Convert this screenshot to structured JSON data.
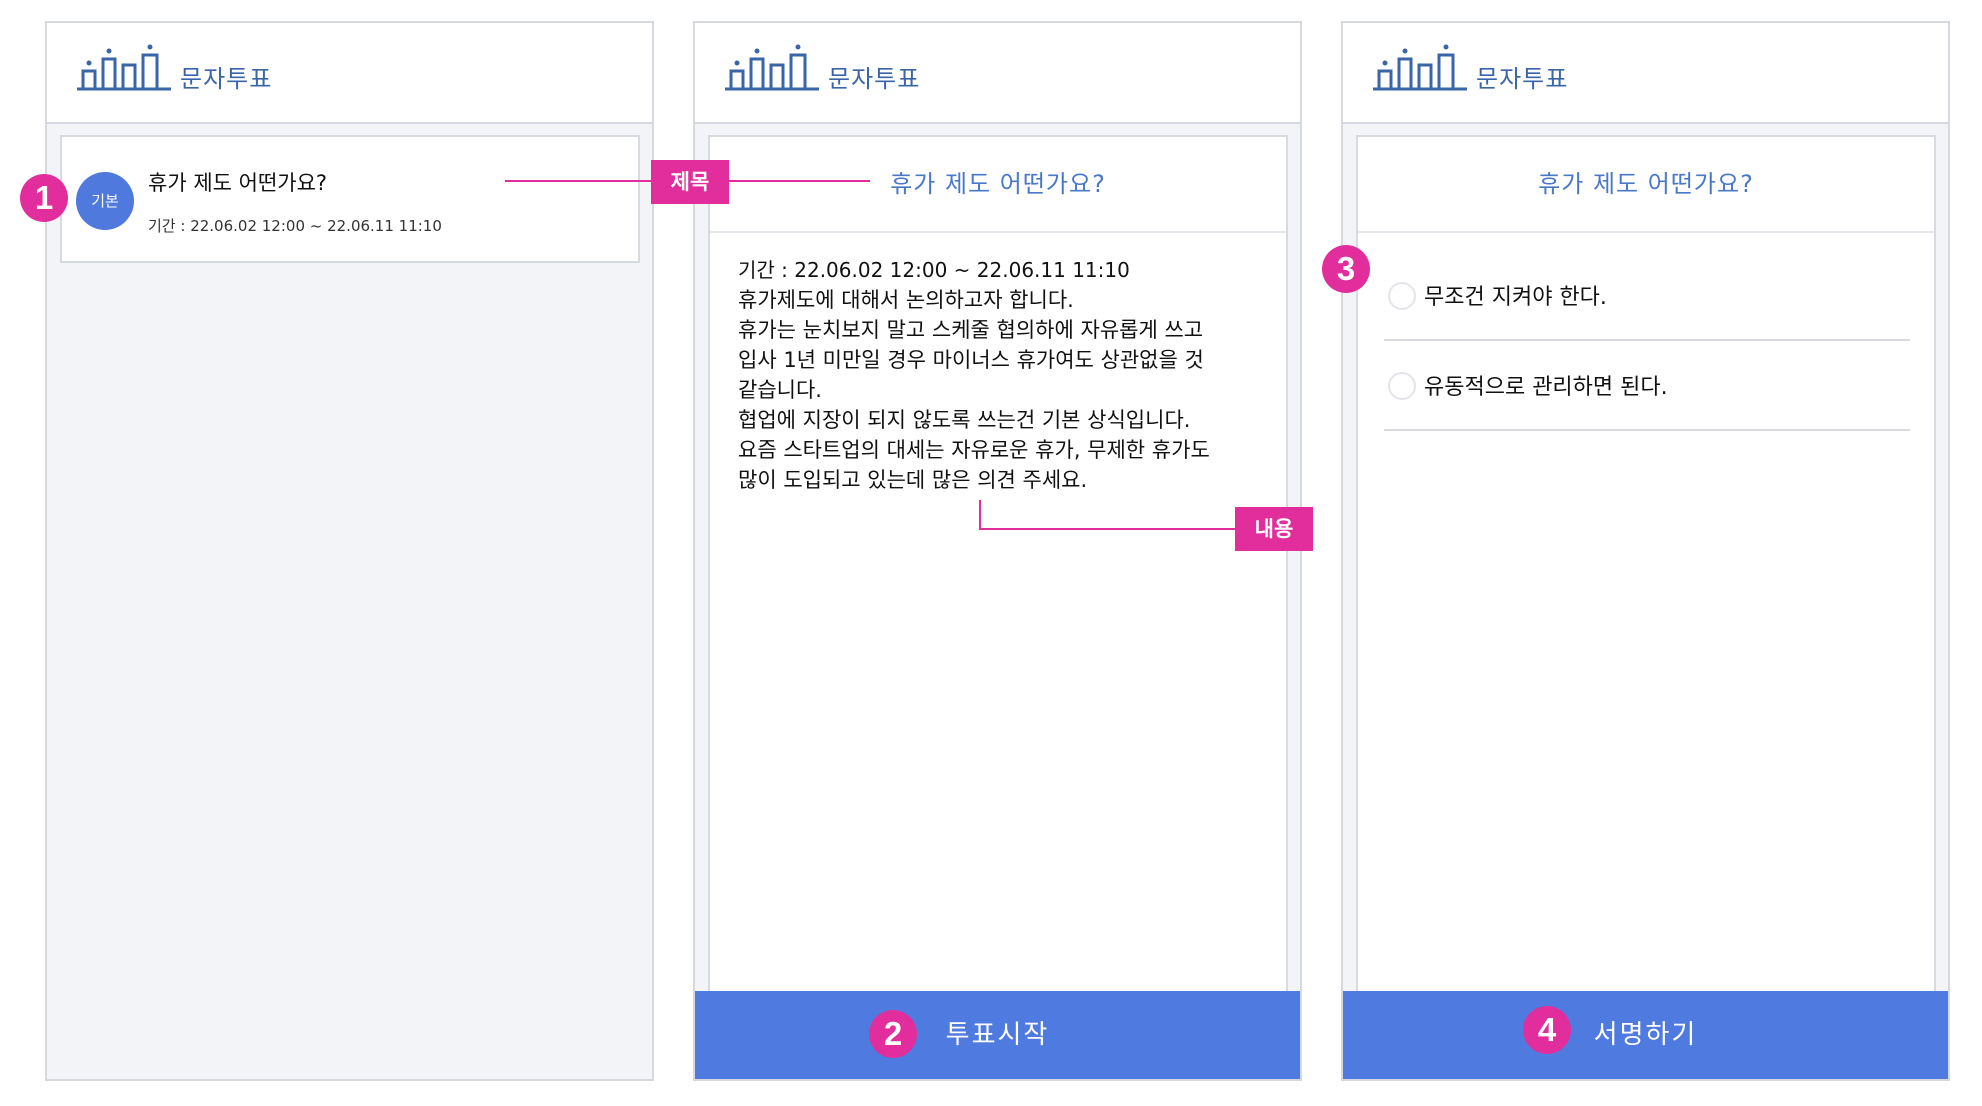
{
  "app": {
    "name": "문자투표",
    "logo_icon": "building-logo-icon"
  },
  "colors": {
    "brand_blue": "#4f7ae0",
    "annotation_pink": "#e22e9c",
    "title_blue": "#4a78c9"
  },
  "screen1": {
    "list_item": {
      "badge": "기본",
      "title": "휴가 제도 어떤가요?",
      "period": "기간 : 22.06.02 12:00 ~ 22.06.11 11:10"
    }
  },
  "screen2": {
    "title": "휴가 제도 어떤가요?",
    "period": "기간 : 22.06.02 12:00 ~ 22.06.11 11:10",
    "body_lines": [
      "휴가제도에 대해서 논의하고자 합니다.",
      "휴가는 눈치보지 말고 스케줄 협의하에 자유롭게 쓰고",
      "입사 1년 미만일 경우 마이너스 휴가여도 상관없을 것",
      "같습니다.",
      "협업에 지장이 되지 않도록 쓰는건 기본 상식입니다.",
      "요즘 스타트업의 대세는 자유로운 휴가, 무제한 휴가도",
      "많이 도입되고 있는데 많은 의견 주세요."
    ],
    "button_label": "투표시작"
  },
  "screen3": {
    "title": "휴가 제도 어떤가요?",
    "options": [
      "무조건 지켜야 한다.",
      "유동적으로 관리하면 된다."
    ],
    "button_label": "서명하기"
  },
  "annotations": {
    "markers": [
      "1",
      "2",
      "3",
      "4"
    ],
    "title_tag": "제목",
    "content_tag": "내용"
  }
}
